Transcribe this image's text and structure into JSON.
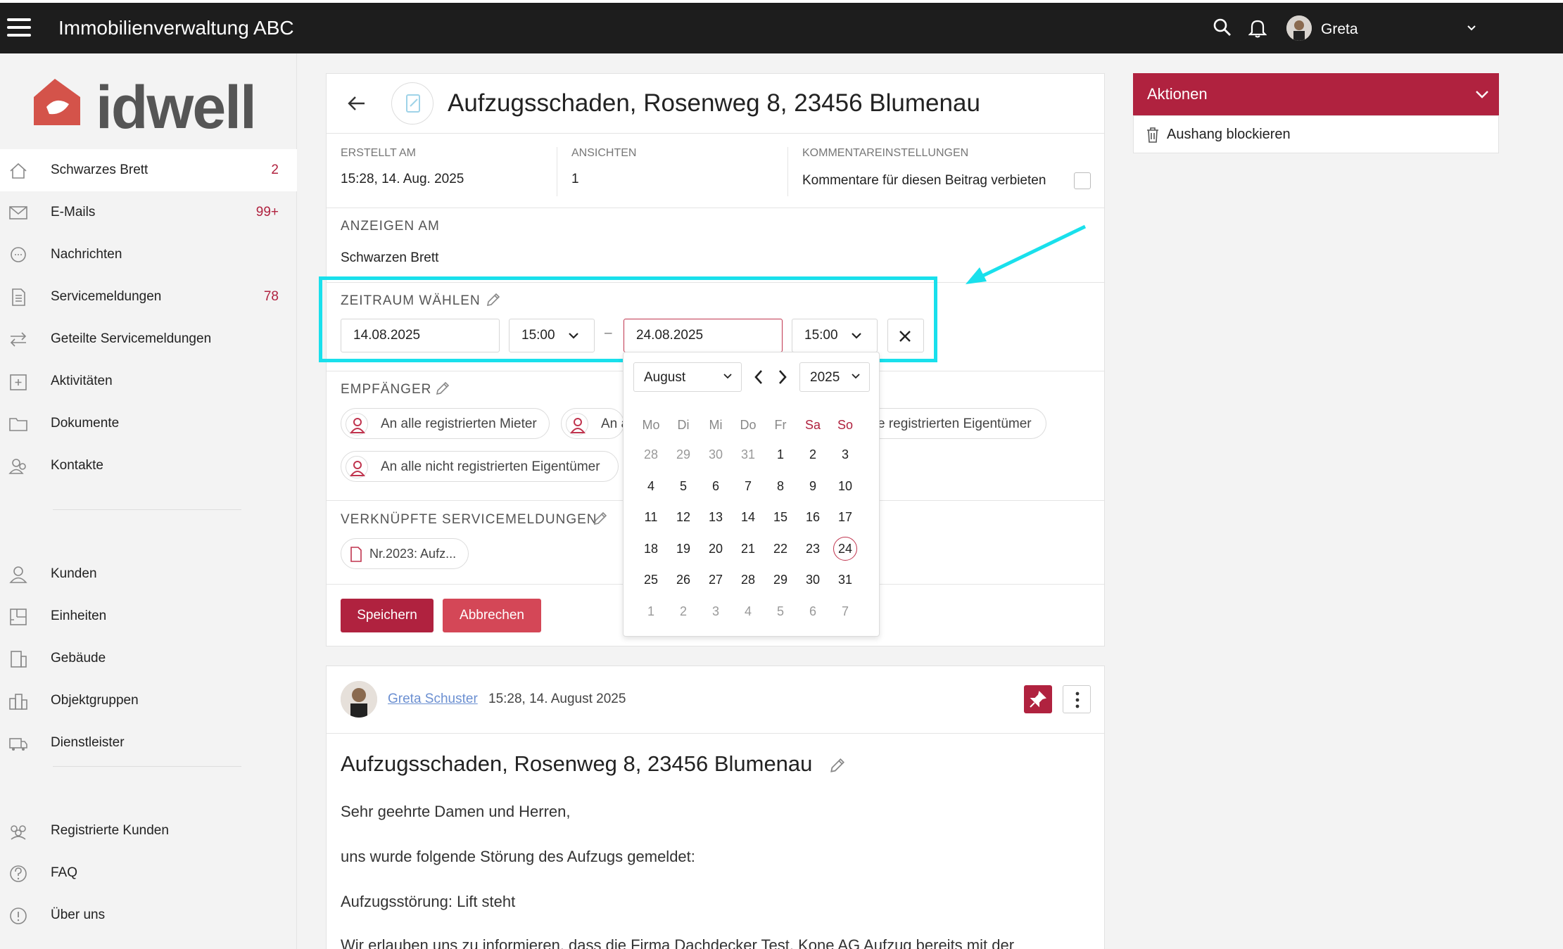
{
  "topbar": {
    "title": "Immobilienverwaltung ABC",
    "user_name": "Greta"
  },
  "logo": {
    "text": "idwell"
  },
  "sidebar": {
    "items": [
      {
        "label": "Schwarzes Brett",
        "count": "2",
        "icon": "home-icon"
      },
      {
        "label": "E-Mails",
        "count": "99+",
        "icon": "mail-icon"
      },
      {
        "label": "Nachrichten",
        "count": "",
        "icon": "chat-icon"
      },
      {
        "label": "Servicemeldungen",
        "count": "78",
        "icon": "document-icon"
      },
      {
        "label": "Geteilte Servicemeldungen",
        "count": "",
        "icon": "swap-icon"
      },
      {
        "label": "Aktivitäten",
        "count": "",
        "icon": "calendar-plus-icon"
      },
      {
        "label": "Dokumente",
        "count": "",
        "icon": "folder-icon"
      },
      {
        "label": "Kontakte",
        "count": "",
        "icon": "contacts-icon"
      },
      {
        "label": "Kunden",
        "count": "",
        "icon": "person-icon"
      },
      {
        "label": "Einheiten",
        "count": "",
        "icon": "floorplan-icon"
      },
      {
        "label": "Gebäude",
        "count": "",
        "icon": "building-icon"
      },
      {
        "label": "Objektgruppen",
        "count": "",
        "icon": "buildings-icon"
      },
      {
        "label": "Dienstleister",
        "count": "",
        "icon": "truck-icon"
      },
      {
        "label": "Registrierte Kunden",
        "count": "",
        "icon": "group-icon"
      },
      {
        "label": "FAQ",
        "count": "",
        "icon": "question-icon"
      },
      {
        "label": "Über uns",
        "count": "",
        "icon": "info-icon"
      }
    ]
  },
  "header": {
    "title": "Aufzugsschaden, Rosenweg 8, 23456 Blumenau"
  },
  "meta": {
    "created_label": "ERSTELLT AM",
    "created_value": "15:28, 14. Aug. 2025",
    "views_label": "ANSICHTEN",
    "views_value": "1",
    "comments_label": "KOMMENTAREINSTELLUNGEN",
    "comments_value": "Kommentare für diesen Beitrag verbieten"
  },
  "show_on": {
    "label": "ANZEIGEN AM",
    "value": "Schwarzen Brett"
  },
  "period": {
    "label": "ZEITRAUM WÄHLEN",
    "start_date": "14.08.2025",
    "start_time": "15:00",
    "separator": "–",
    "end_date": "24.08.2025",
    "end_time": "15:00"
  },
  "recipients": {
    "label": "EMPFÄNGER",
    "chips": [
      "An alle registrierten Mieter",
      "An a",
      "alle registrierten Eigentümer",
      "An alle nicht registrierten Eigentümer"
    ]
  },
  "linked": {
    "label": "VERKNÜPFTE SERVICEMELDUNGEN",
    "chip": "Nr.2023: Aufz..."
  },
  "buttons": {
    "save": "Speichern",
    "cancel": "Abbrechen"
  },
  "calendar": {
    "month": "August",
    "year": "2025",
    "weekdays": [
      "Mo",
      "Di",
      "Mi",
      "Do",
      "Fr",
      "Sa",
      "So"
    ],
    "weeks": [
      [
        "28",
        "29",
        "30",
        "31",
        "1",
        "2",
        "3"
      ],
      [
        "4",
        "5",
        "6",
        "7",
        "8",
        "9",
        "10"
      ],
      [
        "11",
        "12",
        "13",
        "14",
        "15",
        "16",
        "17"
      ],
      [
        "18",
        "19",
        "20",
        "21",
        "22",
        "23",
        "24"
      ],
      [
        "25",
        "26",
        "27",
        "28",
        "29",
        "30",
        "31"
      ],
      [
        "1",
        "2",
        "3",
        "4",
        "5",
        "6",
        "7"
      ]
    ],
    "selected": "24"
  },
  "post": {
    "author": "Greta Schuster",
    "timestamp": "15:28, 14. August 2025",
    "title": "Aufzugsschaden, Rosenweg 8, 23456 Blumenau",
    "paragraphs": [
      "Sehr geehrte Damen und Herren,",
      "uns wurde folgende Störung des Aufzugs gemeldet:",
      "Aufzugsstörung: Lift steht",
      "Wir erlauben uns zu informieren, dass die Firma Dachdecker Test, Kone AG Aufzug bereits mit der"
    ]
  },
  "actions": {
    "title": "Aktionen",
    "items": [
      "Aushang blockieren"
    ]
  },
  "colors": {
    "brand": "#b0223f",
    "highlight": "#19e0ec",
    "topbar": "#1d1d1d"
  }
}
